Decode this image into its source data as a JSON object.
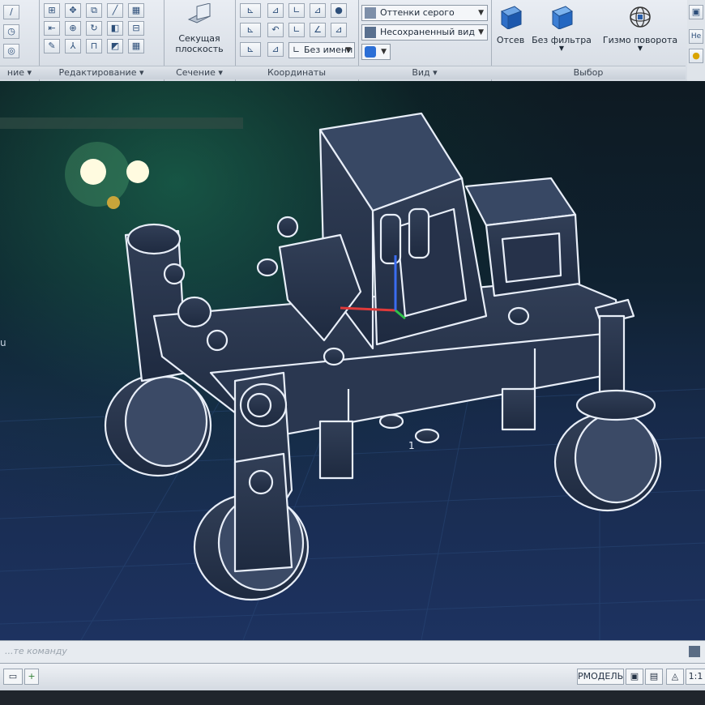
{
  "ribbon": {
    "panels": {
      "modify": {
        "title": "Редактирование ▾"
      },
      "section": {
        "title": "Сечение ▾",
        "button": "Секущая плоскость"
      },
      "coordinates": {
        "title": "Координаты",
        "named_ucs": "Без имени"
      },
      "view": {
        "title": "Вид ▾",
        "visual_style": "Оттенки серого",
        "saved_view": "Несохраненный вид"
      },
      "selection": {
        "title": "Выбор",
        "culling": "Отсев",
        "no_filter": "Без фильтра",
        "gizmo": "Гизмо поворота"
      }
    },
    "left_panel_title": "ние ▾",
    "right_edge_label": "Не"
  },
  "viewport": {
    "ucs_label": "1",
    "left_edge_fragment": "u",
    "axis_colors": {
      "x": "#e03a3a",
      "y": "#2fc24a",
      "z": "#3a6cf0"
    }
  },
  "command_line": {
    "prompt": "...те команду"
  },
  "status_bar": {
    "model_label": "РМОДЕЛЬ",
    "scale": "1:1"
  },
  "colors": {
    "wireframe": "#e8eef8",
    "viewport_bottom": "#1d3260",
    "ribbon_bg": "#e2e7ed"
  }
}
